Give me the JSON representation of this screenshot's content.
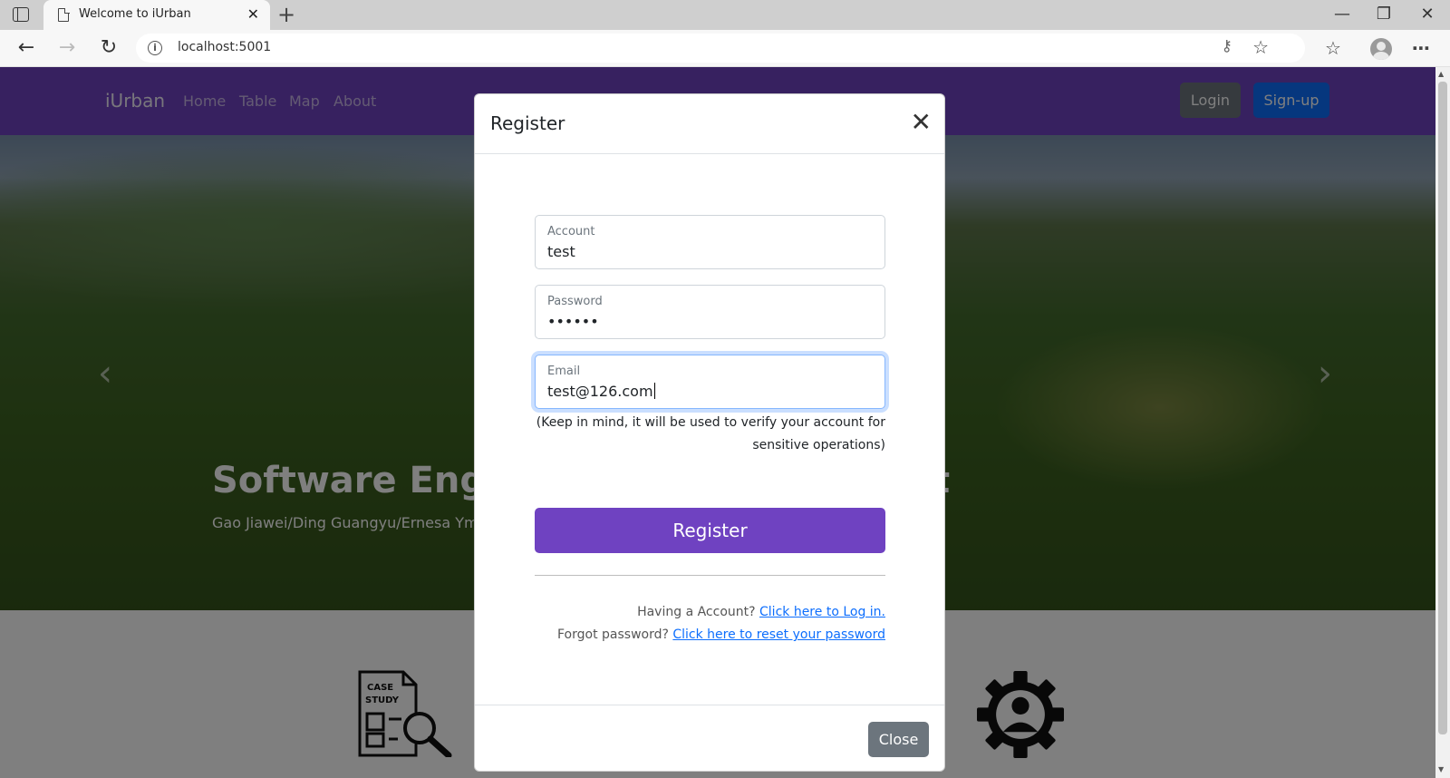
{
  "browser": {
    "tab_title": "Welcome to iUrban",
    "tab_close": "✕",
    "new_tab": "+",
    "url": "localhost:5001",
    "window_controls": {
      "minimize": "—",
      "maximize": "❐",
      "close": "✕"
    },
    "icons": [
      "sidebar-icon",
      "page-icon",
      "back-arrow-icon",
      "forward-arrow-icon",
      "refresh-icon",
      "info-icon",
      "key-icon",
      "favorite-star-icon",
      "favorites-icon",
      "profile-icon",
      "more-icon"
    ]
  },
  "site": {
    "brand": "iUrban",
    "nav": [
      "Home",
      "Table",
      "Map",
      "About"
    ],
    "login_label": "Login",
    "signup_label": "Sign-up",
    "hero_title": "Software Engineering Group Project",
    "hero_subtitle": "Gao Jiawei/Ding Guangyu/Ernesa Ymer",
    "feature_icons": [
      "case-study-icon",
      "gear-person-icon"
    ],
    "colors": {
      "navbar": "#6f42c1",
      "login": "#6c757d",
      "signup": "#0d6efd"
    }
  },
  "modal": {
    "title": "Register",
    "close_x": "✕",
    "fields": {
      "account": {
        "label": "Account",
        "value": "test"
      },
      "password": {
        "label": "Password",
        "value": "••••••"
      },
      "email": {
        "label": "Email",
        "value": "test@126.com"
      }
    },
    "hint_line1": "(Keep in mind, it will be used to verify your account for",
    "hint_line2": "sensitive operations)",
    "register_label": "Register",
    "having_account_text": "Having a Account?",
    "login_link": "Click here to Log in.",
    "forgot_text": "Forgot password?",
    "reset_link": "Click here to reset your password",
    "close_label": "Close",
    "colors": {
      "register_button": "#6f42c1",
      "close_button": "#6c757d",
      "link": "#0d6efd"
    }
  }
}
